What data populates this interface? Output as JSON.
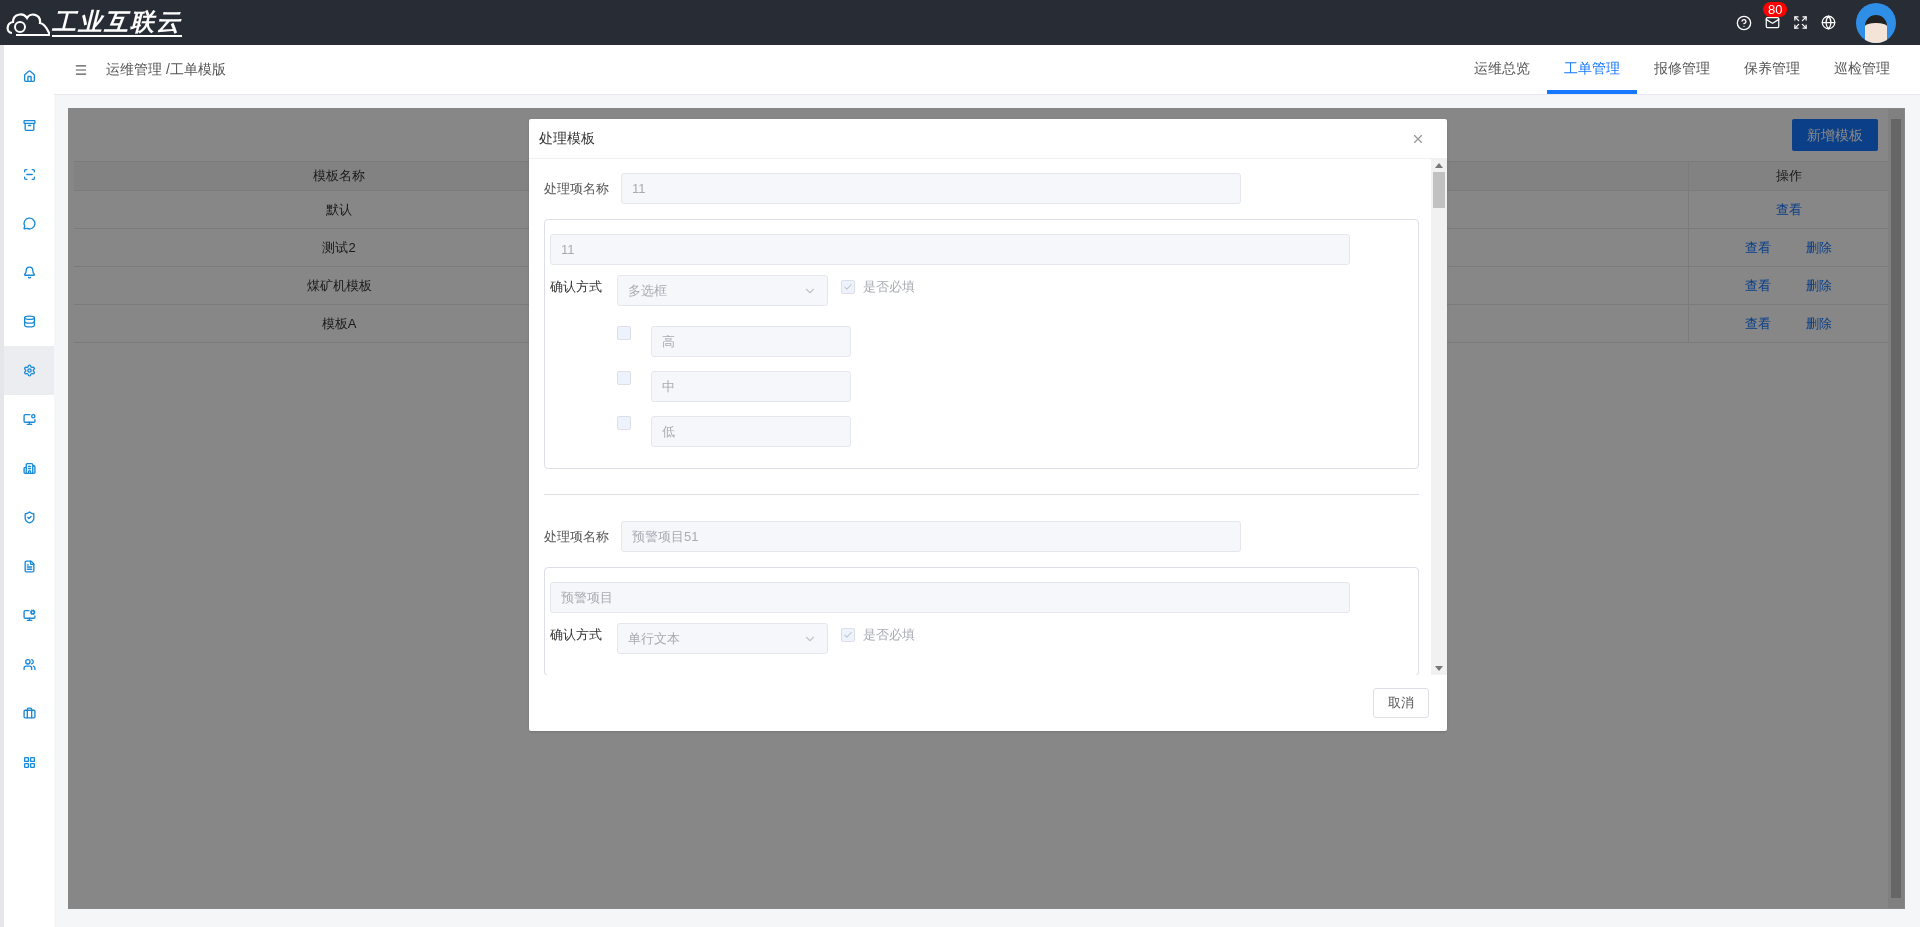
{
  "header": {
    "logo_text": "工业互联云",
    "mail_count": "80"
  },
  "sidebar": {
    "items": [
      {
        "selected": false
      },
      {
        "selected": false
      },
      {
        "selected": false
      },
      {
        "selected": false
      },
      {
        "selected": false
      },
      {
        "selected": false
      },
      {
        "selected": true
      },
      {
        "selected": false
      },
      {
        "selected": false
      },
      {
        "selected": false
      },
      {
        "selected": false
      },
      {
        "selected": false
      },
      {
        "selected": false
      },
      {
        "selected": false
      },
      {
        "selected": false
      }
    ]
  },
  "breadcrumb": "运维管理 /工单模版",
  "tabs": [
    {
      "label": "运维总览",
      "selected": false
    },
    {
      "label": "工单管理",
      "selected": true
    },
    {
      "label": "报修管理",
      "selected": false
    },
    {
      "label": "保养管理",
      "selected": false
    },
    {
      "label": "巡检管理",
      "selected": false
    }
  ],
  "add_button": "新增模板",
  "table": {
    "columns": [
      "模板名称",
      "操作"
    ],
    "rows": [
      {
        "name": "默认",
        "actions": [
          "查看"
        ]
      },
      {
        "name": "测试2",
        "actions": [
          "查看",
          "删除"
        ]
      },
      {
        "name": "煤矿机模板",
        "actions": [
          "查看",
          "删除"
        ]
      },
      {
        "name": "模板A",
        "actions": [
          "查看",
          "删除"
        ]
      }
    ]
  },
  "dialog": {
    "title": "处理模板",
    "items": [
      {
        "label": "处理项名称",
        "name": "11",
        "field": {
          "value": "11",
          "confirm_label": "确认方式",
          "confirm_method": "多选框",
          "required_label": "是否必填",
          "required": true,
          "options": [
            {
              "value": "高",
              "checked": false
            },
            {
              "value": "中",
              "checked": false
            },
            {
              "value": "低",
              "checked": false
            }
          ]
        }
      },
      {
        "label": "处理项名称",
        "name": "预警项目51",
        "field": {
          "value": "预警项目",
          "confirm_label": "确认方式",
          "confirm_method": "单行文本",
          "required_label": "是否必填",
          "required": true
        }
      }
    ],
    "cancel_button": "取消"
  }
}
